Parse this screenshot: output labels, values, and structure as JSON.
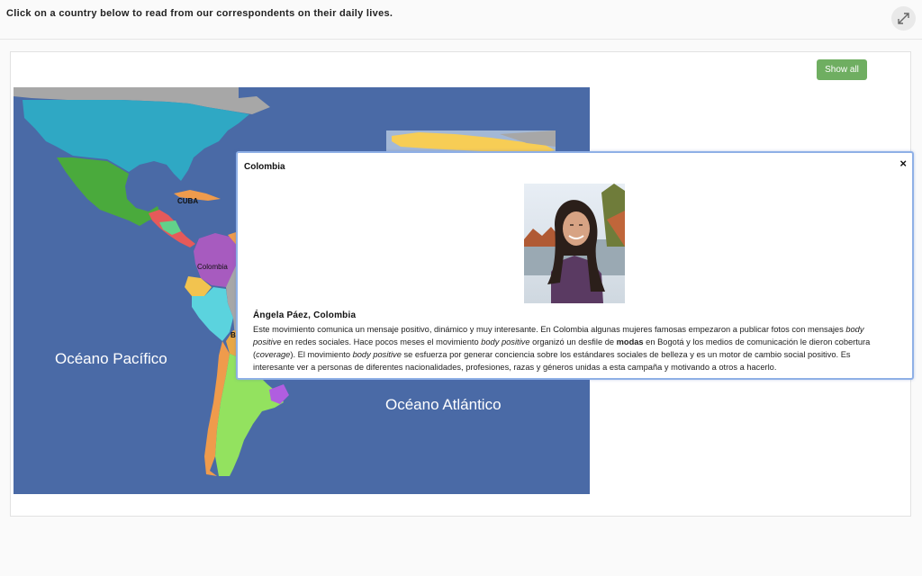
{
  "header": {
    "instruction": "Click on a country below to read from our correspondents on their daily lives."
  },
  "controls": {
    "show_all_label": "Show all",
    "expand_icon": "expand-arrows-icon"
  },
  "map": {
    "ocean_labels": {
      "pacific": "Océano Pacífico",
      "atlantic": "Océano Atlántico"
    },
    "country_labels": {
      "cuba": "CUBA",
      "colombia": "Colombia",
      "partial_b": "B"
    },
    "colors": {
      "ocean": "#4a6aa6",
      "usa": "#2fa8c4",
      "mexico": "#4aaa3c",
      "colombia": "#a75bbf",
      "peru": "#5bd3de",
      "argentina": "#93e25f",
      "chile": "#ef9b4c",
      "ecuador": "#f2c34f",
      "uruguay": "#b05ee0",
      "greenland_like": "#f7cd55",
      "gray": "#a7a7a7"
    }
  },
  "popup": {
    "title": "Colombia",
    "close_label": "×",
    "author": "Ángela Páez, Colombia",
    "text": {
      "p1": "Este movimiento comunica un mensaje positivo, dinámico y muy interesante. En Colombia algunas mujeres famosas empezaron a publicar fotos con mensajes ",
      "em1": "body positive",
      "p2": " en redes sociales. Hace pocos meses el movimiento ",
      "em2": "body positive",
      "p3": " organizó un desfile de ",
      "strong1": "modas",
      "p4": " en Bogotá y los medios de comunicación le dieron cobertura (",
      "em3": "coverage",
      "p5": "). El movimiento ",
      "em4": "body positive",
      "p6": " se esfuerza por generar conciencia sobre los estándares sociales de belleza y es un motor de cambio social positivo. Es interesante ver a personas de diferentes nacionalidades, profesiones, razas y géneros unidas a esta campaña y motivando a otros a hacerlo."
    }
  }
}
